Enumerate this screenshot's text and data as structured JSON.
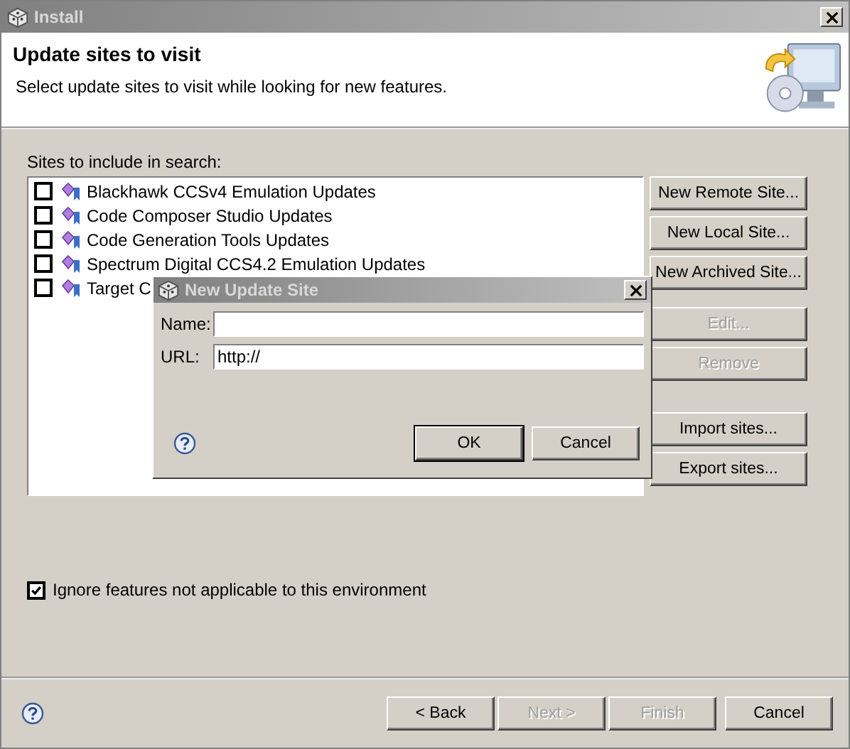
{
  "window": {
    "title": "Install"
  },
  "header": {
    "title": "Update sites to visit",
    "description": "Select update sites to visit while looking for new features."
  },
  "sites_label": "Sites to include in search:",
  "sites": [
    {
      "label": "Blackhawk CCSv4 Emulation Updates",
      "checked": false
    },
    {
      "label": "Code Composer Studio Updates",
      "checked": false
    },
    {
      "label": "Code Generation Tools Updates",
      "checked": false
    },
    {
      "label": "Spectrum Digital CCS4.2 Emulation Updates",
      "checked": false
    },
    {
      "label": "Target C",
      "checked": false
    }
  ],
  "side_buttons": [
    {
      "label": "New Remote Site...",
      "disabled": false
    },
    {
      "label": "New Local Site...",
      "disabled": false
    },
    {
      "label": "New Archived Site...",
      "disabled": false
    },
    {
      "label": "Edit...",
      "disabled": true
    },
    {
      "label": "Remove",
      "disabled": true
    },
    {
      "label": "Import sites...",
      "disabled": false
    },
    {
      "label": "Export sites...",
      "disabled": false
    }
  ],
  "ignore_option": {
    "label": "Ignore features not applicable to this environment",
    "checked": true
  },
  "nav_buttons": [
    {
      "label": "< Back",
      "disabled": false
    },
    {
      "label": "Next >",
      "disabled": true
    },
    {
      "label": "Finish",
      "disabled": true
    },
    {
      "label": "Cancel",
      "disabled": false
    }
  ],
  "dialog": {
    "title": "New Update Site",
    "fields": [
      {
        "label": "Name:"
      },
      {
        "label": "URL:",
        "value": "http://"
      }
    ],
    "buttons": [
      {
        "label": "OK",
        "default": true
      },
      {
        "label": "Cancel",
        "default": false
      }
    ]
  }
}
